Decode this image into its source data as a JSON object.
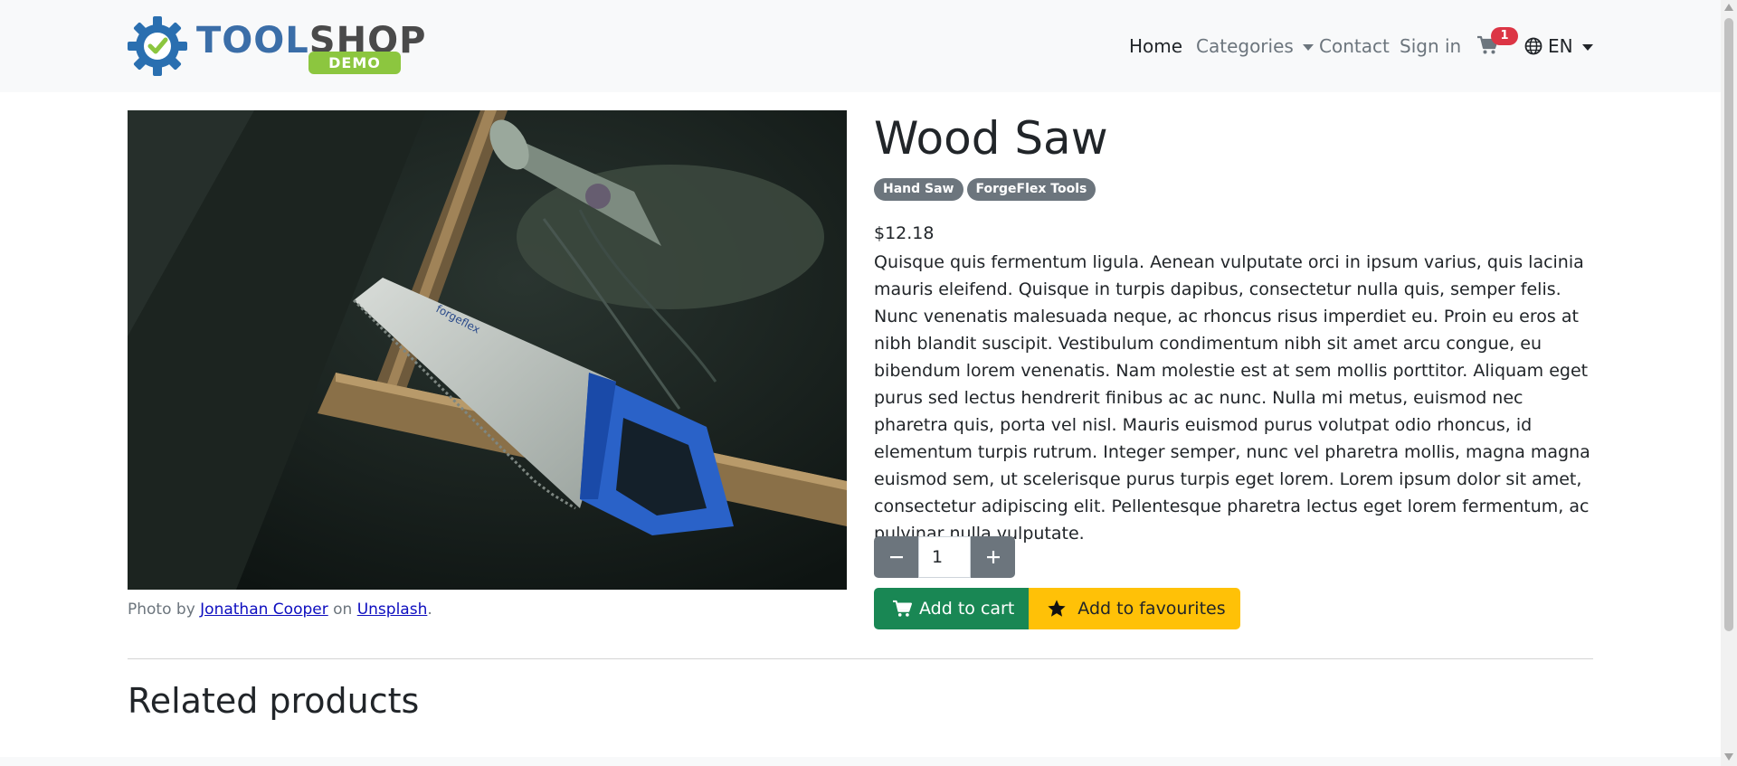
{
  "brand": {
    "name_part1": "TOOL",
    "name_part2": "SHOP",
    "badge": "DEMO",
    "gear_color": "#2a6fb0",
    "check_color": "#8cc63f"
  },
  "nav": {
    "home": "Home",
    "categories": "Categories",
    "contact": "Contact",
    "sign_in": "Sign in",
    "cart_count": "1",
    "language": "EN"
  },
  "product": {
    "title": "Wood Saw",
    "tags": [
      "Hand Saw",
      "ForgeFlex Tools"
    ],
    "price": "$12.18",
    "description": "Quisque quis fermentum ligula. Aenean vulputate orci in ipsum varius, quis lacinia mauris eleifend. Quisque in turpis dapibus, consectetur nulla quis, semper felis. Nunc venenatis malesuada neque, ac rhoncus risus imperdiet eu. Proin eu eros at nibh blandit suscipit. Vestibulum condimentum nibh sit amet arcu congue, eu bibendum lorem venenatis. Nam molestie est at sem mollis porttitor. Aliquam eget purus sed lectus hendrerit finibus ac ac nunc. Nulla mi metus, euismod nec pharetra quis, porta vel nisl. Mauris euismod purus volutpat odio rhoncus, id elementum turpis rutrum. Integer semper, nunc vel pharetra mollis, magna magna euismod sem, ut scelerisque purus turpis eget lorem. Lorem ipsum dolor sit amet, consectetur adipiscing elit. Pellentesque pharetra lectus eget lorem fermentum, ac pulvinar nulla vulputate.",
    "quantity": "1",
    "add_to_cart": "Add to cart",
    "add_to_favourites": "Add to favourites"
  },
  "photo_credit": {
    "prefix": "Photo by",
    "author": "Jonathan Cooper",
    "middle": "on",
    "site": "Unsplash",
    "suffix": "."
  },
  "related": {
    "heading": "Related products"
  },
  "colors": {
    "navbar_bg": "#f8f9fa",
    "badge_gray": "#6c757d",
    "cart_green": "#198754",
    "favourite_yellow": "#ffc107",
    "notification_red": "#dc3545"
  }
}
